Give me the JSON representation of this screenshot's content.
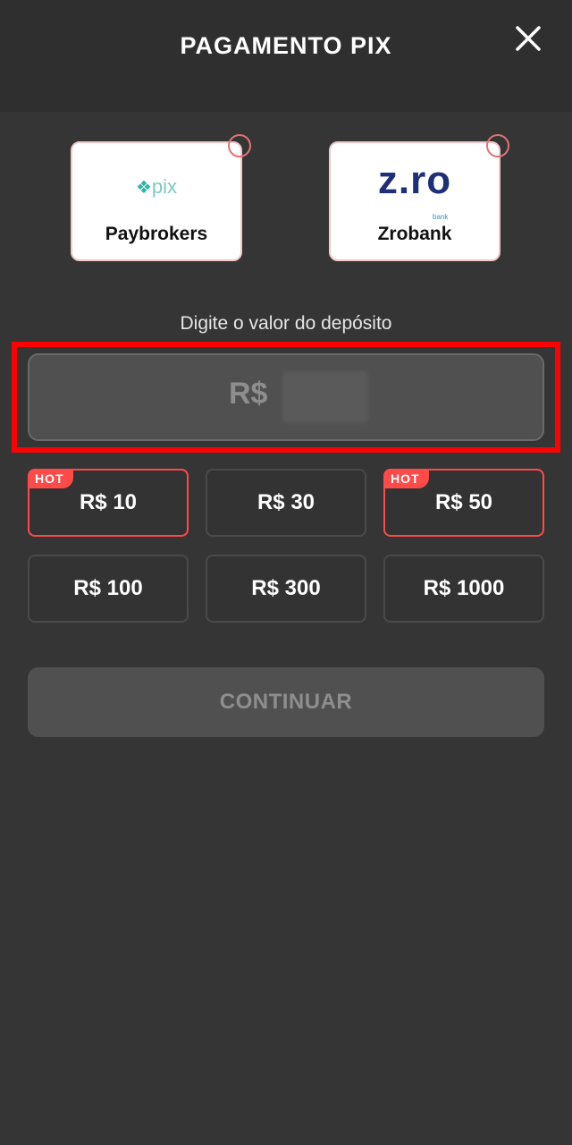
{
  "header": {
    "title": "PAGAMENTO PIX",
    "close_icon": "close-icon"
  },
  "providers": [
    {
      "label": "Paybrokers",
      "logo_text": "pix",
      "logo_icon": "pix-diamond-icon",
      "selected": false
    },
    {
      "label": "Zrobank",
      "logo_text": "z.ro",
      "logo_sub": "bank",
      "selected": false
    }
  ],
  "deposit": {
    "label": "Digite o valor do depósito",
    "currency_prefix": "R$",
    "value": ""
  },
  "amount_options": [
    {
      "label": "R$ 10",
      "hot": true
    },
    {
      "label": "R$ 30",
      "hot": false
    },
    {
      "label": "R$ 50",
      "hot": true
    },
    {
      "label": "R$ 100",
      "hot": false
    },
    {
      "label": "R$ 300",
      "hot": false
    },
    {
      "label": "R$ 1000",
      "hot": false
    }
  ],
  "hot_badge": "HOT",
  "continue_label": "CONTINUAR",
  "colors": {
    "background": "#353535",
    "header": "#2f2f2f",
    "accent_red": "#ff4a4a",
    "highlight_red": "#ff0000",
    "disabled_text": "#8e8e8e"
  }
}
